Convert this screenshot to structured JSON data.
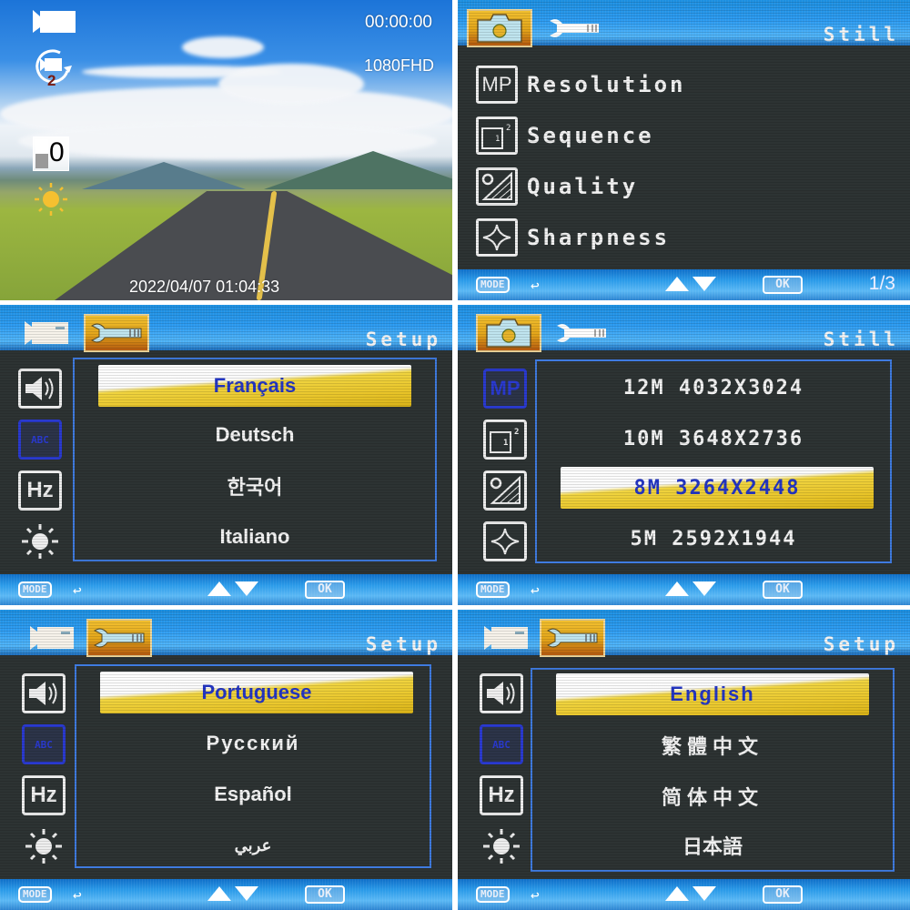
{
  "live_view": {
    "rec_time": "00:00:00",
    "resolution": "1080FHD",
    "loop_minutes": "2",
    "ev_value": "0",
    "timestamp": "2022/04/07 01:04:33",
    "icons": [
      "video-camera-icon",
      "loop-record-icon",
      "exposure-icon",
      "white-balance-sun-icon"
    ]
  },
  "still_main": {
    "title": "Still",
    "tabs": [
      "camera",
      "setup"
    ],
    "active_tab": "camera",
    "items": [
      {
        "icon": "MP",
        "label": "Resolution"
      },
      {
        "icon": "sequence",
        "label": "Sequence"
      },
      {
        "icon": "quality",
        "label": "Quality"
      },
      {
        "icon": "sharpness",
        "label": "Sharpness"
      }
    ],
    "page": "1/3"
  },
  "setup_lang_1": {
    "title": "Setup",
    "options": [
      "Français",
      "Deutsch",
      "한국어",
      "Italiano"
    ],
    "selected": "Français"
  },
  "still_resolution": {
    "title": "Still",
    "options": [
      "12M 4032X3024",
      "10M 3648X2736",
      "8M 3264X2448",
      "5M 2592X1944"
    ],
    "selected": "8M 3264X2448"
  },
  "setup_lang_2": {
    "title": "Setup",
    "options": [
      "Portuguese",
      "Русский",
      "Español",
      "عربي"
    ],
    "selected": "Portuguese"
  },
  "setup_lang_3": {
    "title": "Setup",
    "options": [
      "English",
      "繁體中文",
      "简体中文",
      "日本語"
    ],
    "selected": "English"
  },
  "footer": {
    "mode_label": "MODE",
    "back_glyph": "↩",
    "ok_label": "OK"
  },
  "side_icons": {
    "abc": "ABC",
    "hz": "Hz",
    "mp": "MP"
  },
  "colors": {
    "header_blue": "#2b9af0",
    "menu_bg": "#2d3333",
    "tab_active": "#e3a51a",
    "selection_yellow": "#e9c52a",
    "selection_text": "#2436c4",
    "frame_blue": "#3f7be0"
  }
}
